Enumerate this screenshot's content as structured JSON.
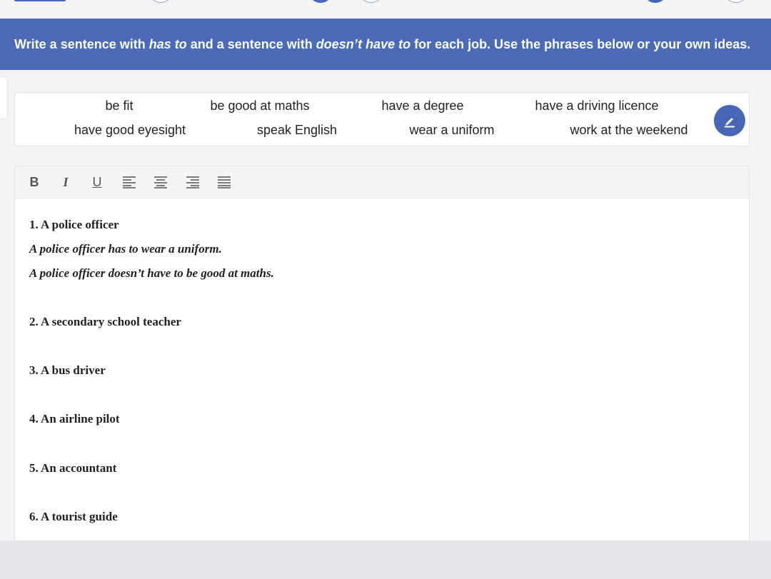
{
  "banner": {
    "part1": "Write a sentence with ",
    "em1": "has to",
    "part2": " and a sentence with ",
    "em2": "doesn’t have to",
    "part3": " for each job. Use the phrases below or your own ideas."
  },
  "phrases": [
    "be fit",
    "be good at maths",
    "have a degree",
    "have a driving licence",
    "have good eyesight",
    "speak English",
    "wear a uniform",
    "work at the weekend"
  ],
  "toolbar": {
    "bold": "B",
    "italic": "I",
    "underline": "U"
  },
  "editor": {
    "items": [
      {
        "heading": "1. A police officer",
        "answers": [
          "A police officer has to wear a uniform.",
          "A police officer doesn’t have to be good at maths."
        ]
      },
      {
        "heading": "2. A secondary school teacher",
        "answers": []
      },
      {
        "heading": "3. A bus driver",
        "answers": []
      },
      {
        "heading": "4. An airline pilot",
        "answers": []
      },
      {
        "heading": "5. An accountant",
        "answers": []
      },
      {
        "heading": "6. A tourist guide",
        "answers": []
      }
    ]
  },
  "colors": {
    "banner": "#4c6bb7",
    "accent": "#4768b6"
  }
}
